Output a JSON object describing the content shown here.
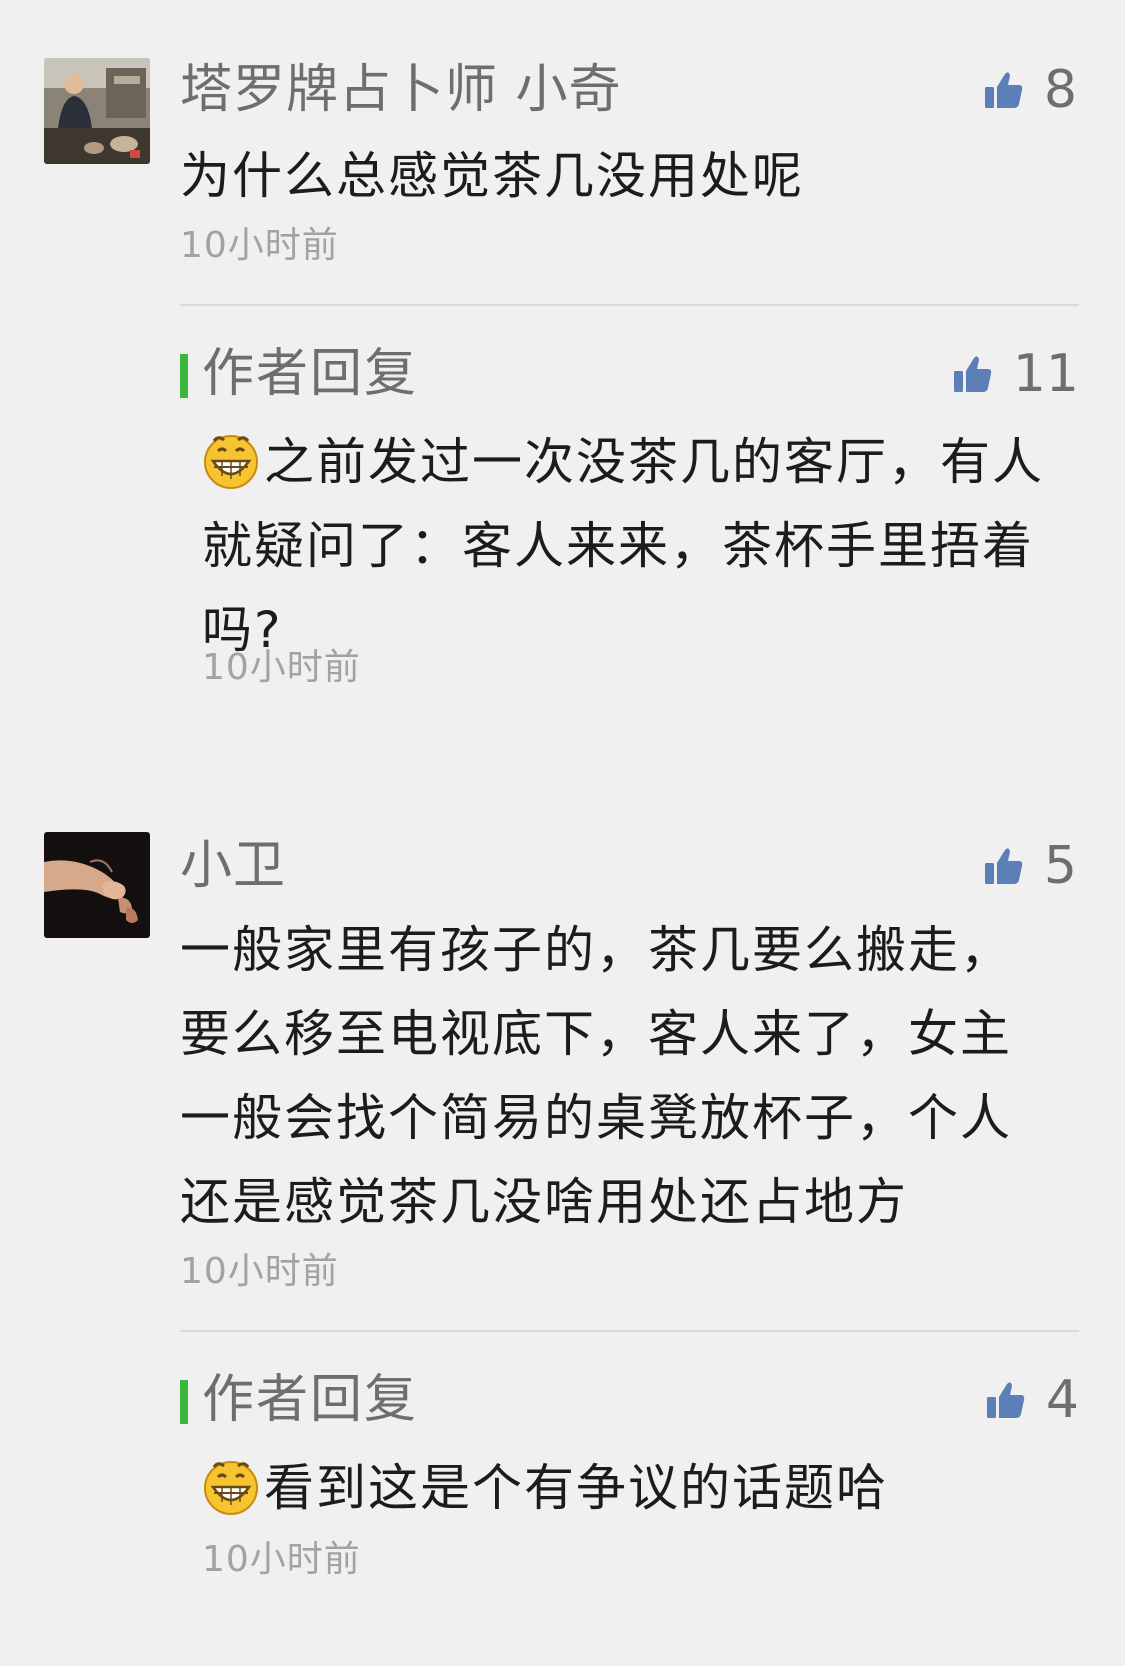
{
  "comments": [
    {
      "nickname": "塔罗牌占卜师 小奇",
      "likes": "8",
      "text": "为什么总感觉茶几没用处呢",
      "time": "10小时前",
      "reply": {
        "label": "作者回复",
        "likes": "11",
        "emoji": "grinning-emoji",
        "text": "之前发过一次没茶几的客厅，有人就疑问了：客人来来，茶杯手里捂着吗?",
        "time": "10小时前"
      }
    },
    {
      "nickname": "小卫",
      "likes": "5",
      "text": "一般家里有孩子的，茶几要么搬走，要么移至电视底下，客人来了，女主一般会找个简易的桌凳放杯子，个人还是感觉茶几没啥用处还占地方",
      "time": "10小时前",
      "reply": {
        "label": "作者回复",
        "likes": "4",
        "emoji": "grinning-emoji",
        "text": "看到这是个有争议的话题哈",
        "time": "10小时前"
      }
    }
  ],
  "colors": {
    "background": "#f0f0f0",
    "reply_accent": "#3bb63b",
    "thumb_icon": "#5b7fb6",
    "secondary_text": "#6e6e6e",
    "time_text": "#a2a2a2"
  }
}
